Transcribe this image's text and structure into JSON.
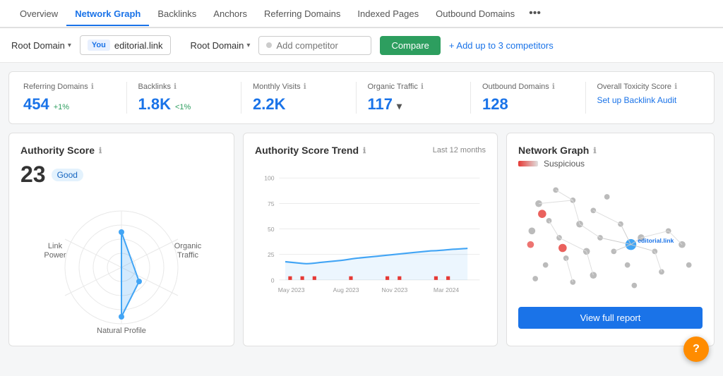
{
  "nav": {
    "items": [
      {
        "label": "Overview",
        "active": false
      },
      {
        "label": "Network Graph",
        "active": true
      },
      {
        "label": "Backlinks",
        "active": false
      },
      {
        "label": "Anchors",
        "active": false
      },
      {
        "label": "Referring Domains",
        "active": false
      },
      {
        "label": "Indexed Pages",
        "active": false
      },
      {
        "label": "Outbound Domains",
        "active": false
      }
    ],
    "more_label": "•••"
  },
  "toolbar": {
    "domain_selector1_label": "Root Domain",
    "domain_selector2_label": "Root Domain",
    "you_label": "You",
    "domain_value": "editorial.link",
    "competitor_placeholder": "Add competitor",
    "compare_label": "Compare",
    "add_competitors_label": "+ Add up to 3 competitors"
  },
  "stats": {
    "referring_domains": {
      "label": "Referring Domains",
      "value": "454",
      "delta": "+1%"
    },
    "backlinks": {
      "label": "Backlinks",
      "value": "1.8K",
      "delta": "<1%"
    },
    "monthly_visits": {
      "label": "Monthly Visits",
      "value": "2.2K"
    },
    "organic_traffic": {
      "label": "Organic Traffic",
      "value": "117"
    },
    "outbound_domains": {
      "label": "Outbound Domains",
      "value": "128"
    },
    "toxicity": {
      "label": "Overall Toxicity Score",
      "setup_label": "Set up Backlink Audit"
    }
  },
  "authority_card": {
    "title": "Authority Score",
    "score": "23",
    "badge": "Good",
    "labels": {
      "link_power": "Link Power",
      "organic_traffic": "Organic Traffic",
      "natural_profile": "Natural Profile"
    }
  },
  "trend_card": {
    "title": "Authority Score Trend",
    "last_months": "Last 12 months",
    "x_labels": [
      "May 2023",
      "Aug 2023",
      "Nov 2023",
      "Mar 2024"
    ],
    "y_labels": [
      "0",
      "25",
      "50",
      "75",
      "100"
    ]
  },
  "network_card": {
    "title": "Network Graph",
    "legend_label": "Suspicious",
    "domain_label": "editorial.link",
    "view_report_label": "View full report"
  },
  "help": {
    "label": "?"
  }
}
